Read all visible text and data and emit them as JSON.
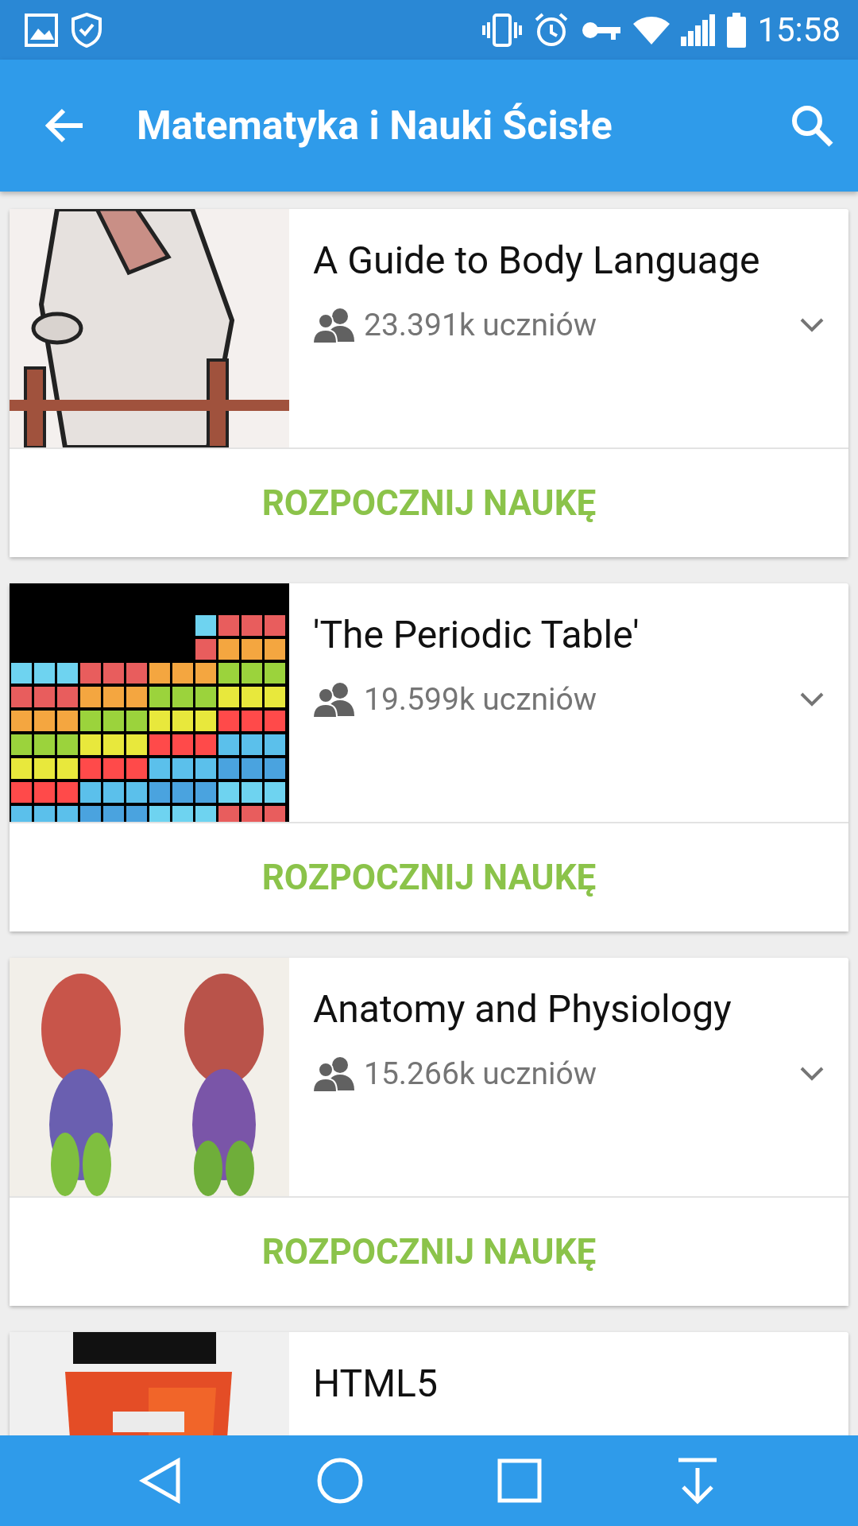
{
  "status_bar": {
    "time": "15:58"
  },
  "app_bar": {
    "title": "Matematyka i Nauki Ścisłe"
  },
  "courses": [
    {
      "title": "A Guide to Body Language",
      "learners": "23.391k uczniów",
      "button": "ROZPOCZNIJ NAUKĘ"
    },
    {
      "title": "'The Periodic Table'",
      "learners": "19.599k uczniów",
      "button": "ROZPOCZNIJ NAUKĘ"
    },
    {
      "title": "Anatomy and Physiology",
      "learners": "15.266k uczniów",
      "button": "ROZPOCZNIJ NAUKĘ"
    },
    {
      "title": "HTML5"
    }
  ]
}
